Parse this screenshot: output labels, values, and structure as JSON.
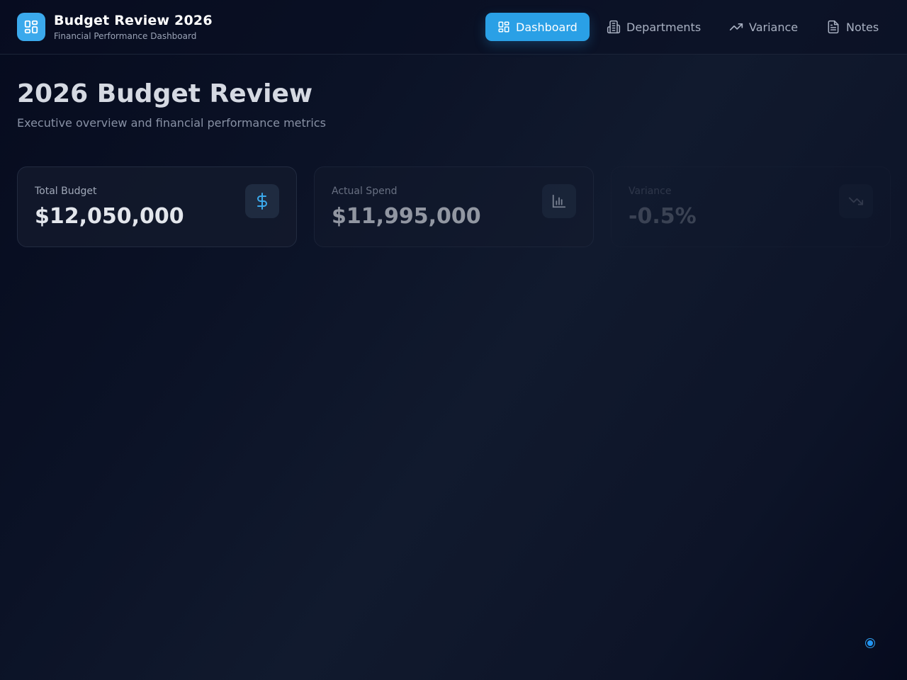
{
  "header": {
    "title": "Budget Review 2026",
    "subtitle": "Financial Performance Dashboard",
    "logo_icon": "grid-icon"
  },
  "nav": [
    {
      "label": "Dashboard",
      "icon": "dashboard-icon",
      "active": true
    },
    {
      "label": "Departments",
      "icon": "building-icon",
      "active": false
    },
    {
      "label": "Variance",
      "icon": "trending-up-icon",
      "active": false
    },
    {
      "label": "Notes",
      "icon": "document-icon",
      "active": false
    }
  ],
  "page": {
    "title": "2026 Budget Review",
    "subtitle": "Executive overview and financial performance metrics"
  },
  "cards": [
    {
      "label": "Total Budget",
      "value": "$12,050,000",
      "icon": "dollar-icon"
    },
    {
      "label": "Actual Spend",
      "value": "$11,995,000",
      "icon": "bar-chart-icon"
    },
    {
      "label": "Variance",
      "value": "-0.5%",
      "icon": "trending-down-icon"
    }
  ],
  "colors": {
    "accent": "#2aa0e6",
    "background": "#0b1226",
    "card": "#141b2e"
  }
}
